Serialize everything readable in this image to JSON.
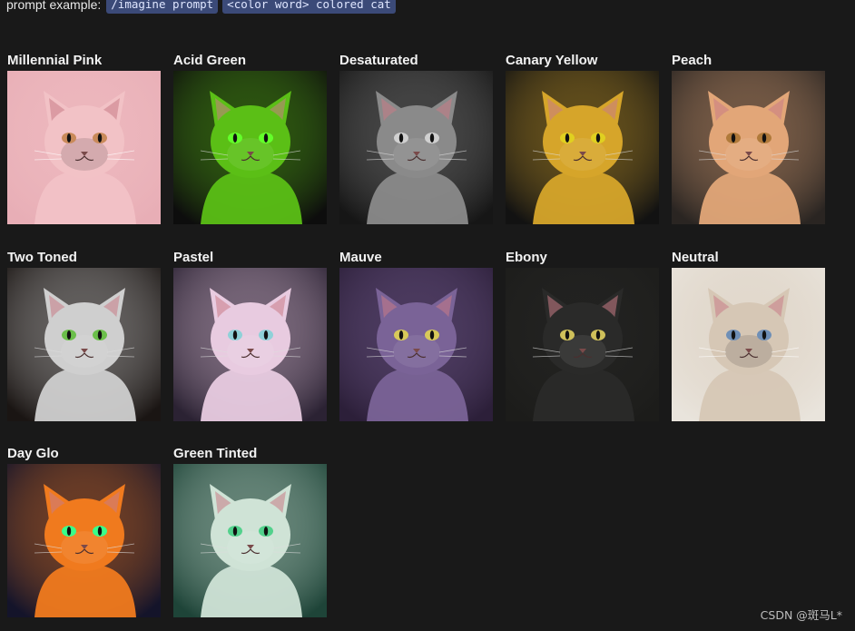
{
  "prompt": {
    "label": "prompt example:",
    "chip1": "/imagine prompt",
    "chip2": "<color word> colored cat"
  },
  "cards": [
    {
      "title": "Millennial Pink",
      "bg": "#e8aeb6",
      "fur": "#f2c2c6",
      "eye": "#c98a5a",
      "icon": "cat-portrait-icon"
    },
    {
      "title": "Acid Green",
      "bg": "#0d0d0d",
      "fur": "#5bbf16",
      "eye": "#63ff2a",
      "icon": "cat-portrait-icon"
    },
    {
      "title": "Desaturated",
      "bg": "#161616",
      "fur": "#8a8a8a",
      "eye": "#d0d0d0",
      "icon": "cat-portrait-icon"
    },
    {
      "title": "Canary Yellow",
      "bg": "#121212",
      "fur": "#d6a52a",
      "eye": "#e0d020",
      "icon": "cat-portrait-icon"
    },
    {
      "title": "Peach",
      "bg": "#2a2522",
      "fur": "#e2a678",
      "eye": "#b07a3a",
      "icon": "cat-portrait-icon"
    },
    {
      "title": "Two Toned",
      "bg": "#1a1513",
      "fur": "#cfcfcf",
      "eye": "#6bbf4a",
      "icon": "cat-portrait-icon"
    },
    {
      "title": "Pastel",
      "bg": "#2b2233",
      "fur": "#e8cbe0",
      "eye": "#8fd1d8",
      "icon": "cat-portrait-icon"
    },
    {
      "title": "Mauve",
      "bg": "#2c1f39",
      "fur": "#7a6397",
      "eye": "#d8c95a",
      "icon": "cat-portrait-icon"
    },
    {
      "title": "Ebony",
      "bg": "#1c1c1a",
      "fur": "#2a2a29",
      "eye": "#cfc05a",
      "icon": "cat-portrait-icon"
    },
    {
      "title": "Neutral",
      "bg": "#e9e4dc",
      "fur": "#d6c7b5",
      "eye": "#6f8fb6",
      "icon": "cat-portrait-icon"
    },
    {
      "title": "Day Glo",
      "bg": "#14142a",
      "fur": "#f07a1e",
      "eye": "#39ff8a",
      "icon": "cat-portrait-icon"
    },
    {
      "title": "Green Tinted",
      "bg": "#1e4438",
      "fur": "#cfe3d6",
      "eye": "#52d18c",
      "icon": "cat-portrait-icon"
    }
  ],
  "watermark": "CSDN @斑马L*"
}
